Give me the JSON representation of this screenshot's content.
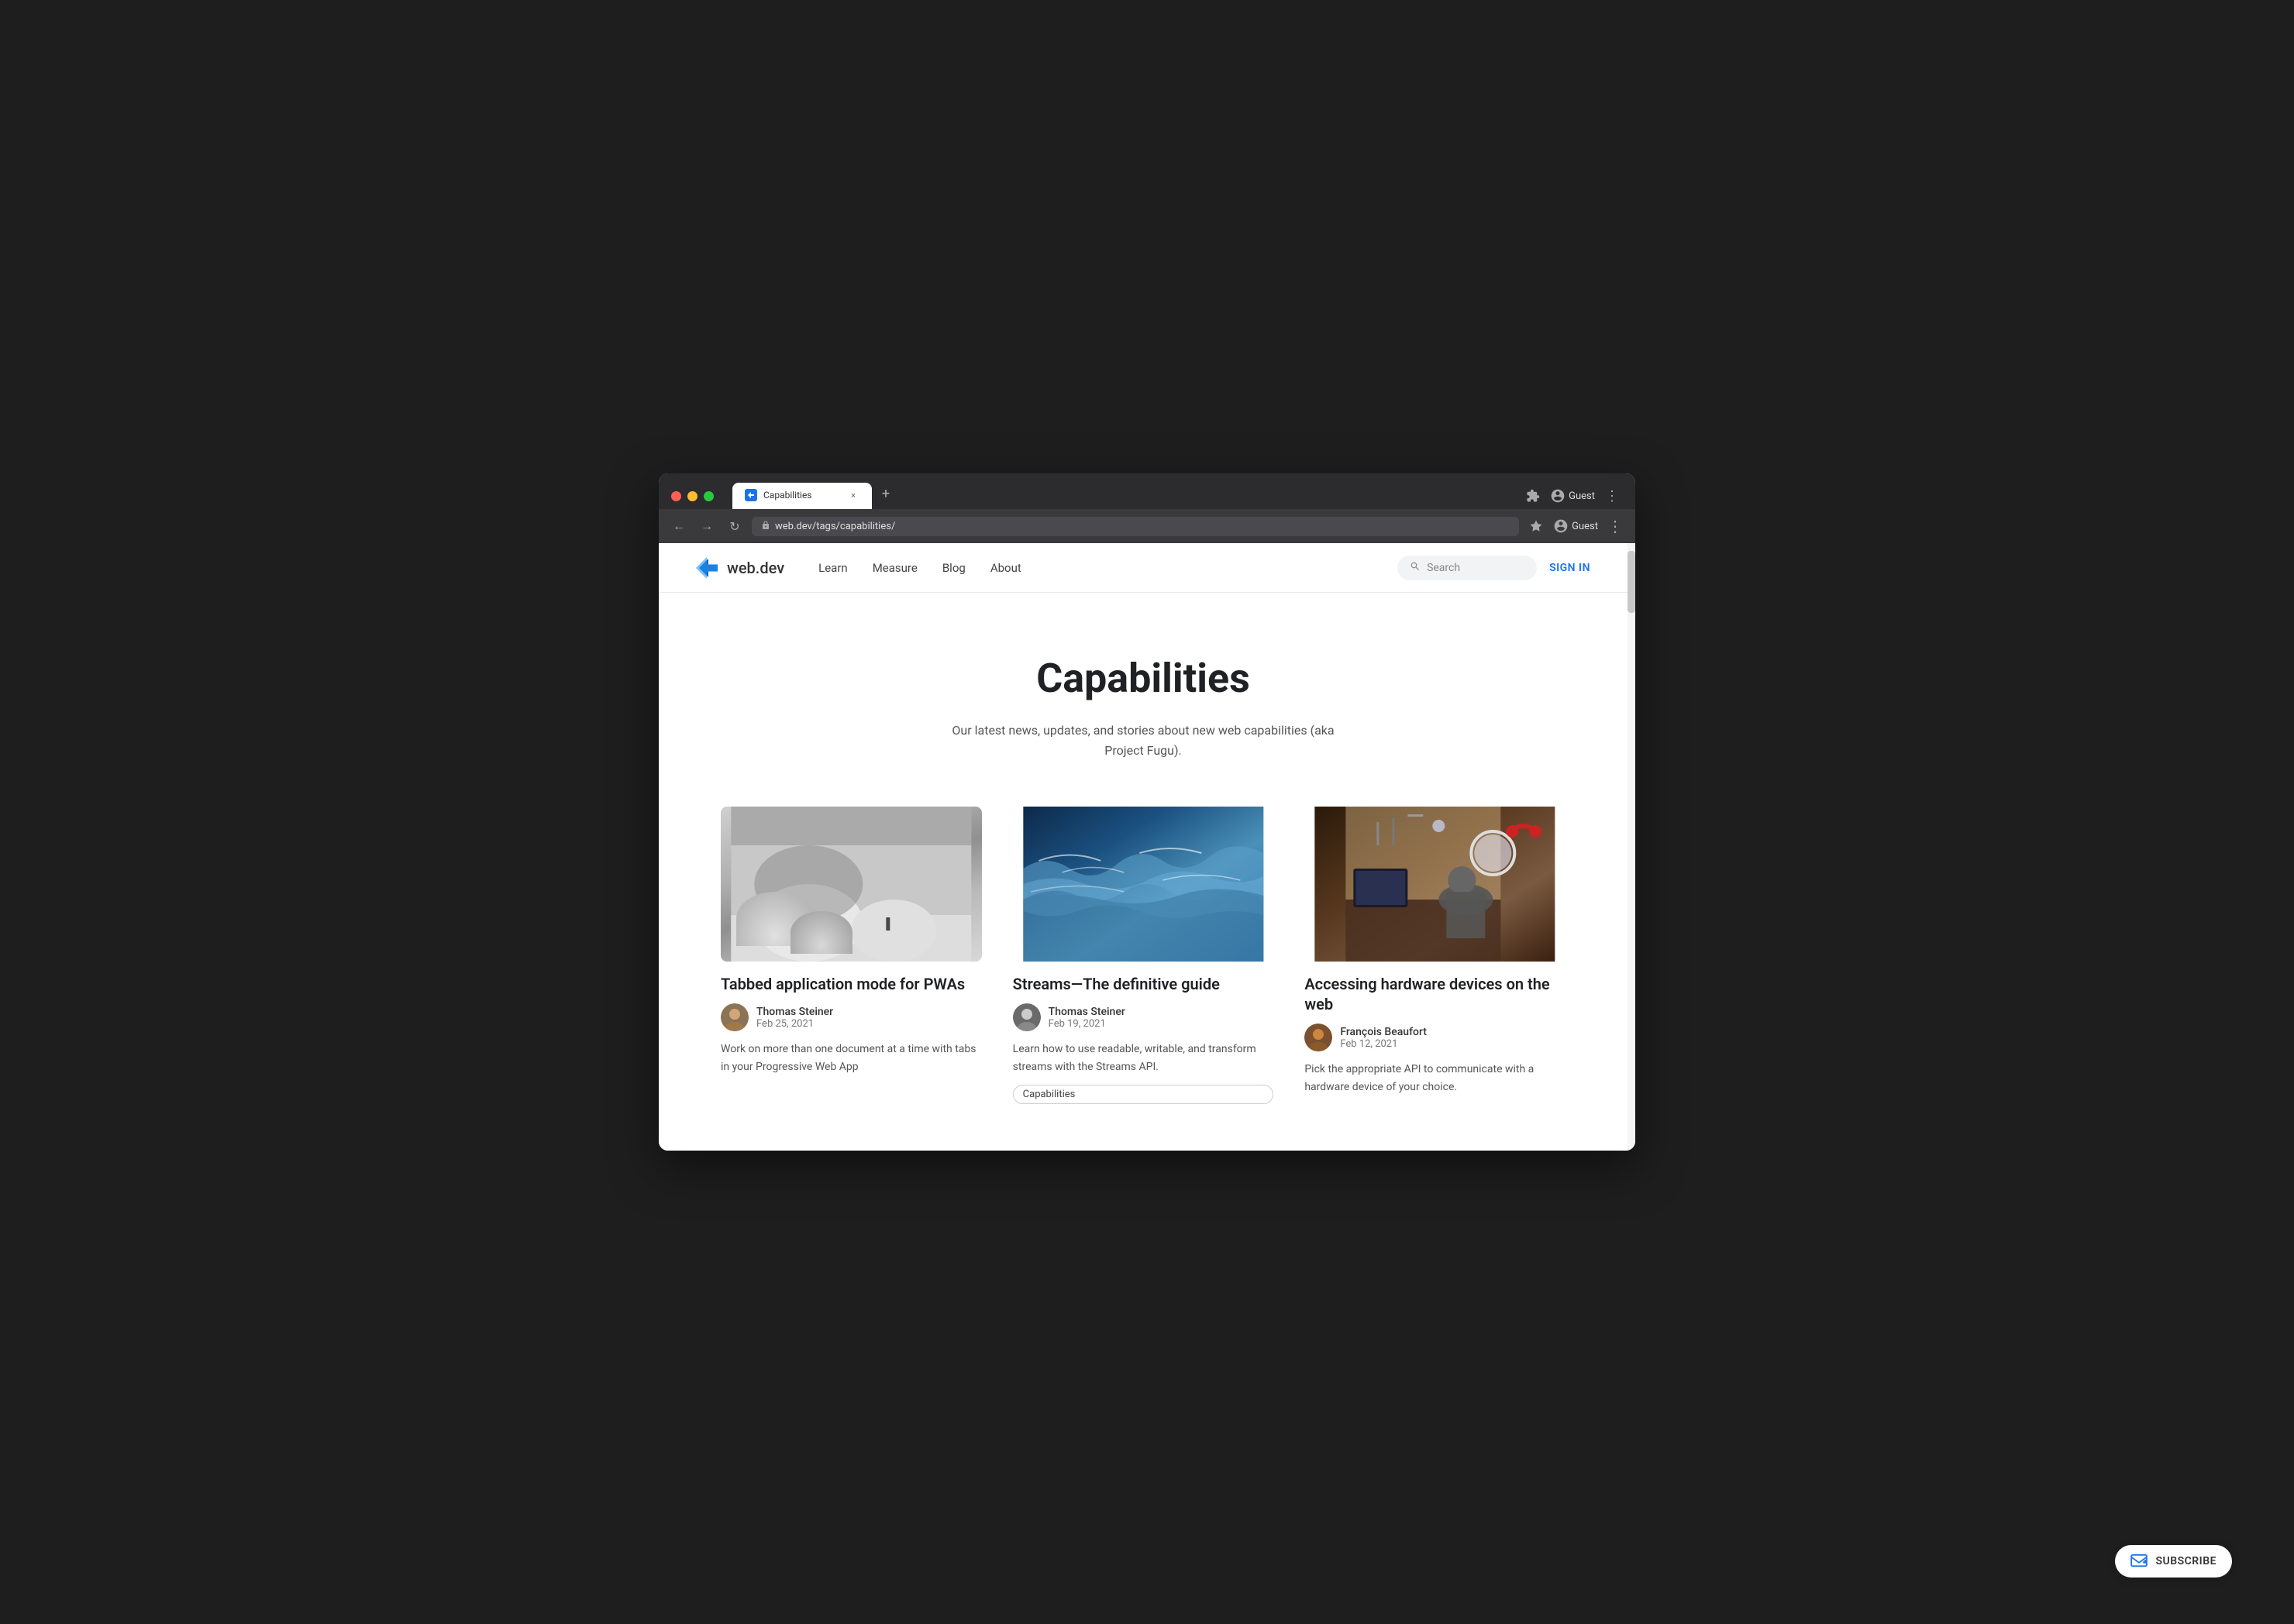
{
  "browser": {
    "tab": {
      "favicon": "🔵",
      "title": "Capabilities",
      "close_label": "×"
    },
    "new_tab_label": "+",
    "nav": {
      "back_icon": "←",
      "forward_icon": "→",
      "refresh_icon": "↻",
      "url": "web.dev/tags/capabilities/",
      "lock_icon": "🔒"
    },
    "extras": {
      "extensions_icon": "⬆",
      "profile_icon": "👤",
      "profile_name": "Guest",
      "menu_icon": "⋮"
    }
  },
  "site": {
    "logo_text": "web.dev",
    "nav_links": [
      {
        "label": "Learn",
        "id": "learn"
      },
      {
        "label": "Measure",
        "id": "measure"
      },
      {
        "label": "Blog",
        "id": "blog"
      },
      {
        "label": "About",
        "id": "about"
      }
    ],
    "search_placeholder": "Search",
    "sign_in_label": "SIGN IN"
  },
  "hero": {
    "title": "Capabilities",
    "description": "Our latest news, updates, and stories about new web capabilities (aka Project Fugu)."
  },
  "articles": [
    {
      "id": "article-1",
      "image_type": "snow-domes",
      "title": "Tabbed application mode for PWAs",
      "author_name": "Thomas Steiner",
      "date": "Feb 25, 2021",
      "excerpt": "Work on more than one document at a time with tabs in your Progressive Web App",
      "tag": null
    },
    {
      "id": "article-2",
      "image_type": "streams",
      "title": "Streams—The definitive guide",
      "author_name": "Thomas Steiner",
      "date": "Feb 19, 2021",
      "excerpt": "Learn how to use readable, writable, and transform streams with the Streams API.",
      "tag": "Capabilities"
    },
    {
      "id": "article-3",
      "image_type": "hardware",
      "title": "Accessing hardware devices on the web",
      "author_name": "François Beaufort",
      "date": "Feb 12, 2021",
      "excerpt": "Pick the appropriate API to communicate with a hardware device of your choice.",
      "tag": null
    }
  ],
  "subscribe": {
    "label": "SUBSCRIBE",
    "icon": "✉"
  }
}
